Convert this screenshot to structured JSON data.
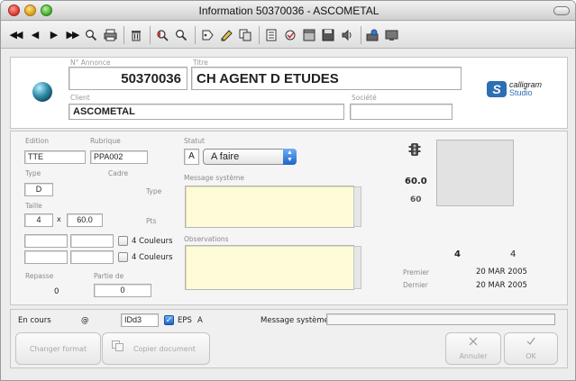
{
  "window": {
    "title": "Information 50370036 - ASCOMETAL"
  },
  "toolbar": {
    "icons": [
      "first-record-icon",
      "previous-record-icon",
      "next-record-icon",
      "last-record-icon",
      "search-icon",
      "print-icon",
      "trash-icon",
      "find-icon",
      "zoom-icon",
      "tag-icon",
      "edit-icon",
      "duplicate-icon",
      "document-icon",
      "approve-icon",
      "archive-icon",
      "save-icon",
      "sound-icon",
      "user-icon",
      "monitor-icon"
    ],
    "glyphs": {
      "first": "◀◀",
      "prev": "◀",
      "next": "▶",
      "last": "▶▶"
    }
  },
  "header": {
    "annonce_label": "N° Annonce",
    "annonce_value": "50370036",
    "titre_label": "Titre",
    "titre_value": "CH AGENT D ETUDES",
    "client_label": "Client",
    "client_value": "ASCOMETAL",
    "societe_label": "Société",
    "societe_value": "",
    "logo_line1": "calligram",
    "logo_line2": "Studio"
  },
  "main": {
    "edition_label": "Edition",
    "edition_value": "TTE",
    "rubrique_label": "Rubrique",
    "rubrique_value": "PPA002",
    "statut_label": "Statut",
    "statut_code": "A",
    "statut_value": "A faire",
    "type_label": "Type",
    "type_value": "D",
    "cadre_label": "Cadre",
    "cadre_type_label": "Type",
    "message_label": "Message système",
    "taille_label": "Taille",
    "taille_width": "4",
    "taille_x": "x",
    "taille_height": "60.0",
    "pts_label": "Pts",
    "couleurs_label_1": "4 Couleurs",
    "couleurs_label_2": "4 Couleurs",
    "observations_label": "Observations",
    "repasse_label": "Repasse",
    "repasse_value": "0",
    "partie_label": "Partie de",
    "partie_value": "0",
    "size_value": "60.0",
    "size_value_2": "60",
    "count_left": "4",
    "count_right": "4",
    "premier_label": "Premier",
    "premier_value": "20 MAR 2005",
    "dernier_label": "Dernier",
    "dernier_value": "20 MAR 2005"
  },
  "status": {
    "en_cours_label": "En cours",
    "en_cours_value": "@",
    "id_value": "IDd3",
    "eps_label": "EPS",
    "eps_checked": true,
    "eps_code": "A",
    "message_label": "Message système",
    "message_value": "",
    "changer_format_label": "Changer format",
    "copier_document_label": "Copier document",
    "annuler_label": "Annuler",
    "ok_label": "OK"
  }
}
